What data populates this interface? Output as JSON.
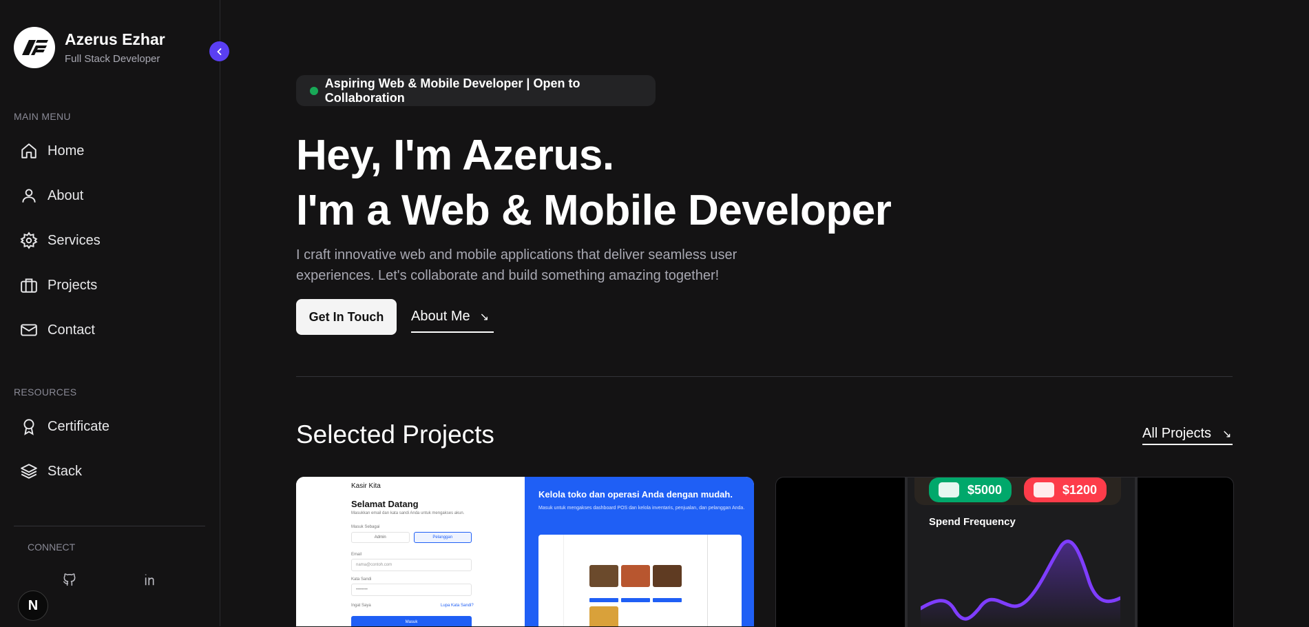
{
  "profile": {
    "name": "Azerus Ezhar",
    "role": "Full Stack Developer",
    "logo_icon": "ae-logo"
  },
  "sidebar": {
    "main_menu_label": "MAIN MENU",
    "main_menu": [
      {
        "label": "Home",
        "icon": "home-icon"
      },
      {
        "label": "About",
        "icon": "user-icon"
      },
      {
        "label": "Services",
        "icon": "gear-icon"
      },
      {
        "label": "Projects",
        "icon": "briefcase-icon"
      },
      {
        "label": "Contact",
        "icon": "mail-icon"
      }
    ],
    "resources_label": "RESOURCES",
    "resources": [
      {
        "label": "Certificate",
        "icon": "award-icon"
      },
      {
        "label": "Stack",
        "icon": "layers-icon"
      }
    ],
    "connect_label": "CONNECT",
    "social": [
      "github-icon",
      "linkedin-icon"
    ],
    "badge": "N"
  },
  "hero": {
    "status": "Aspiring Web & Mobile Developer | Open to Collaboration",
    "title_line1": "Hey, I'm Azerus.",
    "title_line2": "I'm a Web & Mobile Developer",
    "description": "I craft innovative web and mobile applications that deliver seamless user experiences. Let's collaborate and build something amazing together!",
    "cta_primary": "Get In Touch",
    "cta_secondary": "About Me"
  },
  "projects": {
    "title": "Selected Projects",
    "all_link": "All Projects",
    "card1": {
      "brand": "Kasir Kita",
      "heading": "Selamat Datang",
      "subheading": "Masukkan email dan kata sandi Anda untuk mengakses akun.",
      "role_label": "Masuk Sebagai",
      "tab_admin": "Admin",
      "tab_customer": "Pelanggan",
      "email_label": "Email",
      "email_placeholder": "nama@contoh.com",
      "password_label": "Kata Sandi",
      "password_placeholder": "••••••••",
      "remember": "Ingat Saya",
      "forgot": "Lupa Kata Sandi?",
      "submit": "Masuk",
      "promo_title": "Kelola toko dan operasi Anda dengan mudah.",
      "promo_sub": "Masuk untuk mengakses dashboard POS dan kelola inventaris, penjualan, dan pelanggan Anda."
    },
    "card2": {
      "chip1": "$5000",
      "chip2": "$1200",
      "chart_title": "Spend Frequency",
      "chip1_color": "#00a86b",
      "chip2_color": "#fd3c4a",
      "line_color": "#7f3dff"
    }
  },
  "colors": {
    "accent": "#5a3ff2",
    "status_dot": "#18a957",
    "background": "#141314"
  }
}
